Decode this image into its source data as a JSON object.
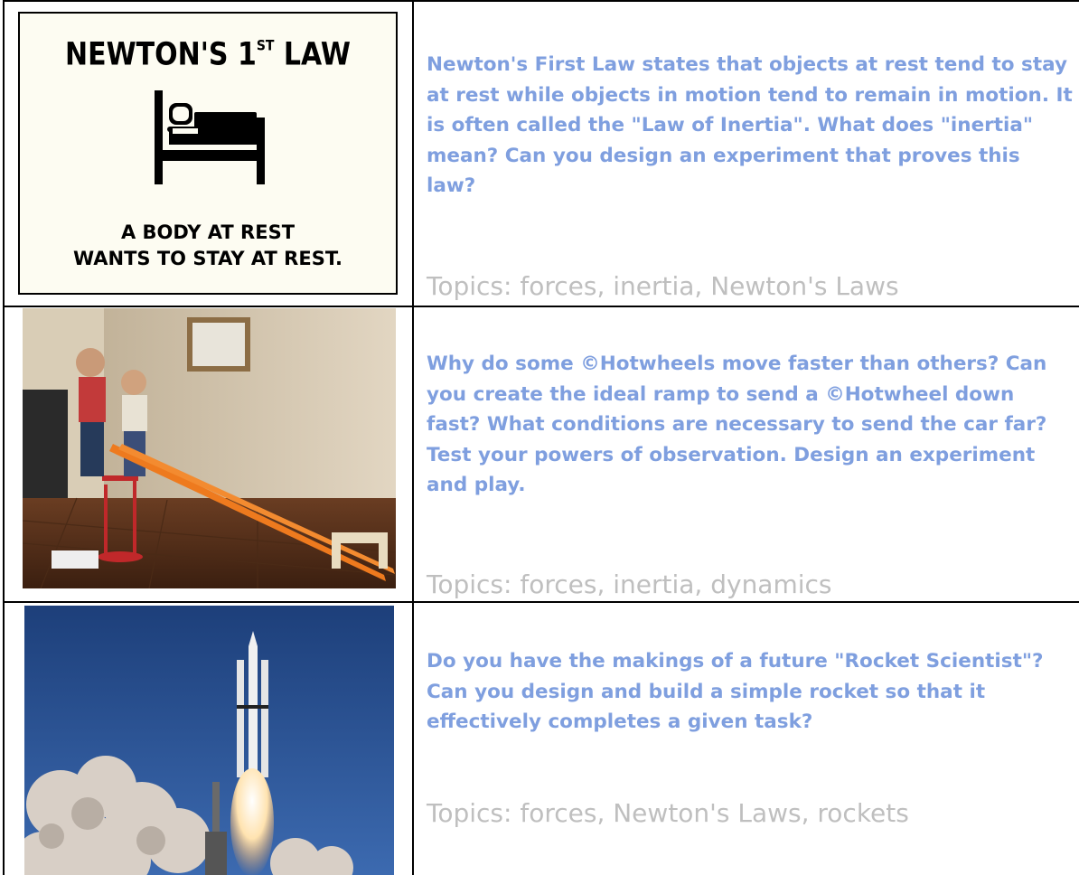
{
  "rows": [
    {
      "poster": {
        "title_main": "NEWTON'S 1",
        "title_sup": "ST",
        "title_end": " LAW",
        "caption_line1": "A BODY AT REST",
        "caption_line2": "WANTS TO STAY AT REST."
      },
      "question": "Newton's First Law states that objects at rest tend to stay at rest while objects in motion tend to remain in motion. It is often called the \"Law of Inertia\". What does \"inertia\" mean? Can you design an experiment that proves this law?",
      "topics": "Topics: forces, inertia, Newton's Laws"
    },
    {
      "question": "Why do some ©Hotwheels move faster than others? Can you create the ideal ramp to send a ©Hotwheel down fast? What conditions are necessary to send the car far? Test your powers of observation. Design an experiment and play.",
      "topics": "Topics: forces, inertia, dynamics"
    },
    {
      "question": "Do you have the makings of a future \"Rocket Scientist\"? Can you design and build a simple rocket so that it effectively completes a given task?",
      "topics": "Topics: forces, Newton's Laws, rockets"
    }
  ],
  "colors": {
    "question": "#7f9fdf",
    "topics": "#bfbfbf",
    "grid": "#000000"
  }
}
